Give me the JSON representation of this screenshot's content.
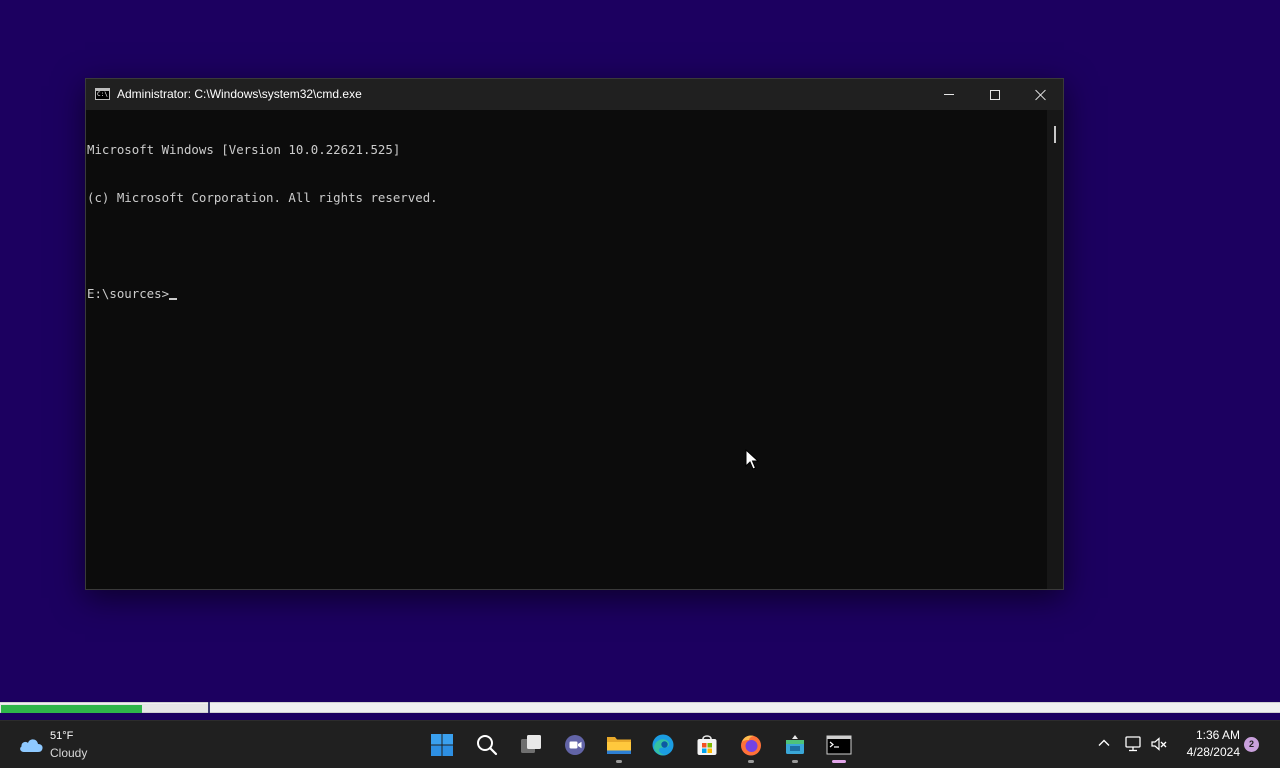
{
  "window": {
    "title": "Administrator: C:\\Windows\\system32\\cmd.exe",
    "console_lines": [
      "Microsoft Windows [Version 10.0.22621.525]",
      "(c) Microsoft Corporation. All rights reserved.",
      "",
      "E:\\sources>"
    ],
    "window_icon": "cmd-icon",
    "controls": {
      "minimize": "minimize-icon",
      "maximize": "maximize-icon",
      "close": "close-icon"
    }
  },
  "progress": {
    "fraction": 0.11
  },
  "taskbar": {
    "weather": {
      "temp": "51°F",
      "condition": "Cloudy",
      "icon": "cloud-icon"
    },
    "apps": [
      {
        "name": "start-icon"
      },
      {
        "name": "search-icon"
      },
      {
        "name": "task-view-icon"
      },
      {
        "name": "chat-icon"
      },
      {
        "name": "file-explorer-icon",
        "running": true
      },
      {
        "name": "edge-icon"
      },
      {
        "name": "store-icon"
      },
      {
        "name": "firefox-icon",
        "running": true
      },
      {
        "name": "app-icon",
        "running": true
      },
      {
        "name": "terminal-icon",
        "running": true,
        "active": true
      }
    ],
    "tray": {
      "chevron": "chevron-up-icon",
      "network": "network-icon",
      "volume": "volume-muted-icon"
    },
    "clock": {
      "time": "1:36 AM",
      "date": "4/28/2024"
    },
    "notifications": "2"
  },
  "colors": {
    "desktop": "#1c0060",
    "console_bg": "#0c0c0c",
    "console_text": "#cccccc",
    "taskbar": "#202020",
    "progress": "#2fb54a"
  }
}
